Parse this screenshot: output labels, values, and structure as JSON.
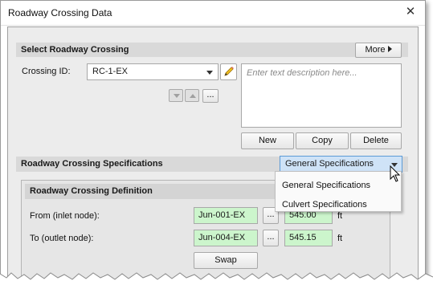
{
  "window": {
    "title": "Roadway Crossing Data"
  },
  "select_section": {
    "title": "Select Roadway Crossing",
    "more_label": "More",
    "crossing_id_label": "Crossing ID:",
    "crossing_id_value": "RC-1-EX",
    "description_placeholder": "Enter text description here...",
    "nav_more_label": "...",
    "new_label": "New",
    "copy_label": "Copy",
    "delete_label": "Delete"
  },
  "specs_section": {
    "title": "Roadway Crossing Specifications",
    "selected": "General Specifications",
    "options": [
      "General Specifications",
      "Culvert Specifications"
    ]
  },
  "definition": {
    "title": "Roadway Crossing Definition",
    "from_label": "From (inlet node):",
    "from_node": "Jun-001-EX",
    "from_elev": "545.00",
    "to_label": "To (outlet node):",
    "to_node": "Jun-004-EX",
    "to_elev": "545.15",
    "unit": "ft",
    "browse_label": "...",
    "swap_label": "Swap"
  }
}
